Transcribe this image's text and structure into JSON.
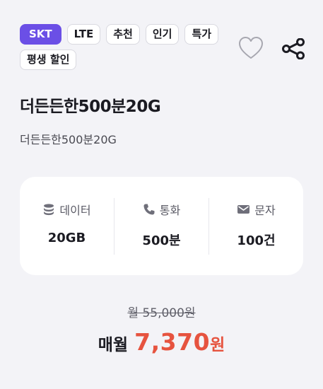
{
  "tags": {
    "row1": [
      "SKT",
      "LTE",
      "추천",
      "인기",
      "특가"
    ],
    "row2": [
      "평생 할인"
    ]
  },
  "actions": {
    "favorite_icon": "heart-outline-icon",
    "share_icon": "share-icon"
  },
  "plan": {
    "title": "더든든한500분20G",
    "subtitle": "더든든한500분20G"
  },
  "specs": [
    {
      "icon": "database-icon",
      "label": "데이터",
      "value": "20GB"
    },
    {
      "icon": "phone-icon",
      "label": "통화",
      "value": "500분"
    },
    {
      "icon": "envelope-icon",
      "label": "문자",
      "value": "100건"
    }
  ],
  "pricing": {
    "original": "월 55,000원",
    "prefix": "매월",
    "amount": "7,370",
    "unit": "원"
  },
  "colors": {
    "carrier_tag_bg": "#6b4fe6",
    "price_accent": "#e6533f",
    "page_bg": "#f3f3f7"
  }
}
